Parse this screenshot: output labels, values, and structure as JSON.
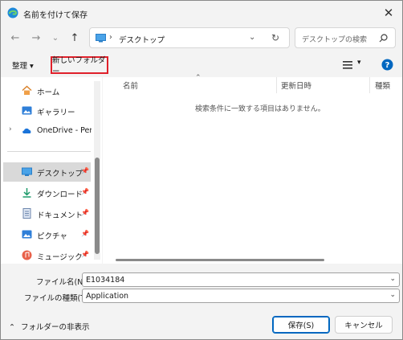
{
  "window": {
    "title": "名前を付けて保存"
  },
  "addressbar": {
    "path": "デスクトップ",
    "separator": "›"
  },
  "search": {
    "placeholder": "デスクトップの検索"
  },
  "toolbar": {
    "organize": "整理",
    "new_folder": "新しいフォルダー"
  },
  "nav": {
    "items": [
      {
        "label": "ホーム",
        "icon": "home-icon"
      },
      {
        "label": "ギャラリー",
        "icon": "gallery-icon"
      },
      {
        "label": "OneDrive - Perso",
        "icon": "cloud-icon"
      },
      {
        "label": "デスクトップ",
        "icon": "desktop-icon",
        "selected": true,
        "pinned": true
      },
      {
        "label": "ダウンロード",
        "icon": "download-icon",
        "pinned": true
      },
      {
        "label": "ドキュメント",
        "icon": "document-icon",
        "pinned": true
      },
      {
        "label": "ピクチャ",
        "icon": "pictures-icon",
        "pinned": true
      },
      {
        "label": "ミュージック",
        "icon": "music-icon",
        "pinned": true
      }
    ]
  },
  "list": {
    "columns": [
      "名前",
      "更新日時",
      "種類"
    ],
    "empty_message": "検索条件に一致する項目はありません。"
  },
  "form": {
    "filename_label": "ファイル名(N):",
    "filename_value": "E1034184",
    "filetype_label": "ファイルの種類(T):",
    "filetype_value": "Application"
  },
  "footer": {
    "hide_folders": "フォルダーの非表示",
    "save": "保存(S)",
    "cancel": "キャンセル"
  },
  "colors": {
    "accent": "#0067c0",
    "highlight_border": "#e0202a",
    "selected_bg": "#d9d9d9"
  }
}
